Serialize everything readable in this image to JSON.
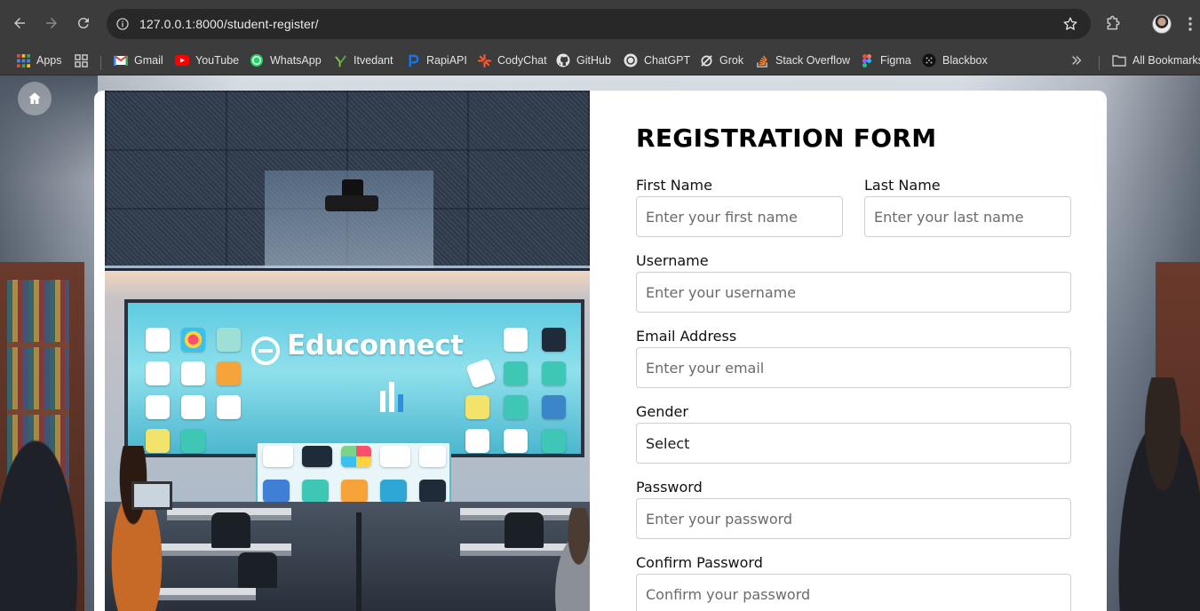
{
  "browser": {
    "url": "127.0.0.1:8000/student-register/",
    "bookmarks": [
      {
        "label": "Apps",
        "icon": "apps-grid-icon"
      },
      {
        "label": "",
        "icon": "tab-groups-icon"
      },
      {
        "label": "Gmail",
        "icon": "gmail-icon"
      },
      {
        "label": "YouTube",
        "icon": "youtube-icon"
      },
      {
        "label": "WhatsApp",
        "icon": "whatsapp-icon"
      },
      {
        "label": "Itvedant",
        "icon": "itvedant-icon"
      },
      {
        "label": "RapiAPI",
        "icon": "rapidapi-icon"
      },
      {
        "label": "CodyChat",
        "icon": "codychat-icon"
      },
      {
        "label": "GitHub",
        "icon": "github-icon"
      },
      {
        "label": "ChatGPT",
        "icon": "chatgpt-icon"
      },
      {
        "label": "Grok",
        "icon": "grok-icon"
      },
      {
        "label": "Stack Overflow",
        "icon": "stackoverflow-icon"
      },
      {
        "label": "Figma",
        "icon": "figma-icon"
      },
      {
        "label": "Blackbox",
        "icon": "blackbox-icon"
      }
    ],
    "all_bookmarks": "All Bookmarks"
  },
  "illustration": {
    "screen_text": "Educonnect"
  },
  "form": {
    "title": "REGISTRATION FORM",
    "first_name": {
      "label": "First Name",
      "placeholder": "Enter your first name"
    },
    "last_name": {
      "label": "Last Name",
      "placeholder": "Enter your last name"
    },
    "username": {
      "label": "Username",
      "placeholder": "Enter your username"
    },
    "email": {
      "label": "Email Address",
      "placeholder": "Enter your email"
    },
    "gender": {
      "label": "Gender",
      "value": "Select"
    },
    "password": {
      "label": "Password",
      "placeholder": "Enter your password"
    },
    "confirm_password": {
      "label": "Confirm Password",
      "placeholder": "Confirm your password"
    }
  },
  "colors": {
    "chrome_bg": "#3c3c3c",
    "omnibox_bg": "#282828",
    "card_bg": "#ffffff",
    "accent_screen": "#5fcbe0"
  }
}
